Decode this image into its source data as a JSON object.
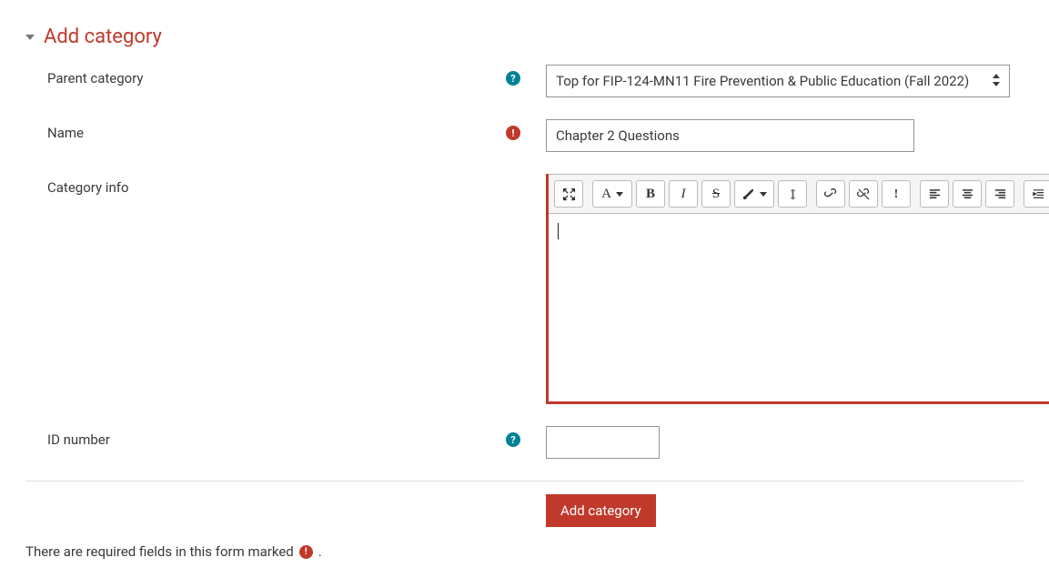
{
  "section": {
    "title": "Add category"
  },
  "labels": {
    "parent_category": "Parent category",
    "name": "Name",
    "category_info": "Category info",
    "id_number": "ID number"
  },
  "fields": {
    "parent_category": {
      "selected": "Top for FIP-124-MN11 Fire Prevention & Public Education (Fall 2022)"
    },
    "name": {
      "value": "Chapter 2 Questions"
    },
    "category_info": {
      "value": ""
    },
    "id_number": {
      "value": ""
    }
  },
  "editor_toolbar": {
    "buttons": {
      "fullscreen": "fullscreen-icon",
      "paragraph": "A",
      "bold": "B",
      "italic": "I",
      "strike": "S",
      "textcolor": "color-icon",
      "clear": "clear-icon",
      "link": "link-icon",
      "unlink": "unlink-icon",
      "emoji": "!",
      "align_left": "align-left-icon",
      "align_center": "align-center-icon",
      "align_right": "align-right-icon",
      "indent": "indent-icon"
    }
  },
  "buttons": {
    "submit": "Add category"
  },
  "footnote": {
    "text_before": "There are required fields in this form marked",
    "text_after": "."
  },
  "icons": {
    "help": "?",
    "required": "!"
  }
}
